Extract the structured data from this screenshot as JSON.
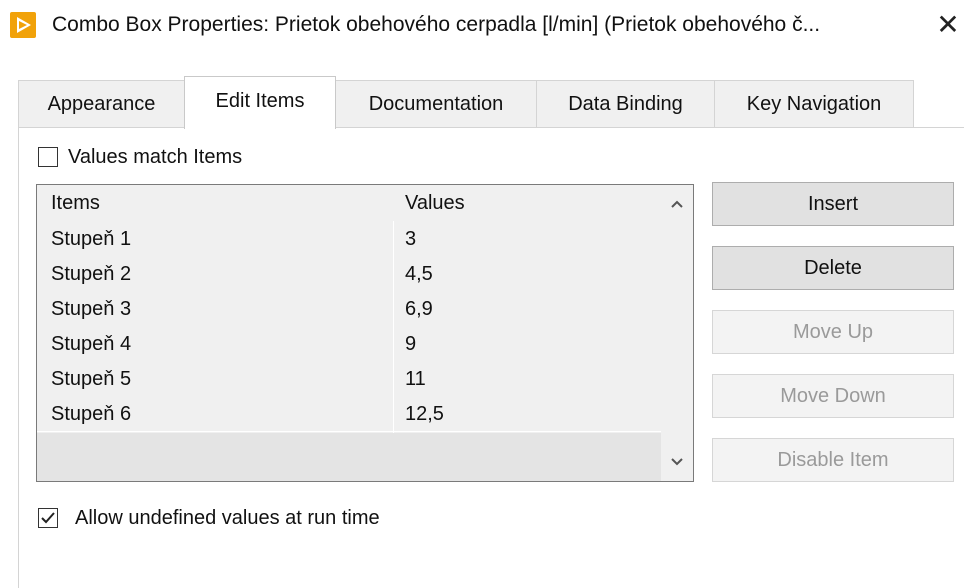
{
  "window": {
    "title": "Combo Box Properties: Prietok obehového cerpadla [l/min] (Prietok obehového č...",
    "close_glyph": "✕",
    "icon": "labview-run-arrow-icon",
    "accent_color": "#f1a20a"
  },
  "tabs": [
    {
      "label": "Appearance",
      "active": false
    },
    {
      "label": "Edit Items",
      "active": true
    },
    {
      "label": "Documentation",
      "active": false
    },
    {
      "label": "Data Binding",
      "active": false
    },
    {
      "label": "Key Navigation",
      "active": false
    }
  ],
  "values_match_items": {
    "label": "Values match Items",
    "checked": false
  },
  "list": {
    "columns": [
      "Items",
      "Values"
    ],
    "rows": [
      {
        "item": "Stupeň 1",
        "value": "3"
      },
      {
        "item": "Stupeň 2",
        "value": "4,5"
      },
      {
        "item": "Stupeň 3",
        "value": "6,9"
      },
      {
        "item": "Stupeň 4",
        "value": "9"
      },
      {
        "item": "Stupeň 5",
        "value": "11"
      },
      {
        "item": "Stupeň 6",
        "value": "12,5"
      }
    ],
    "scroll_up_glyph": "⌃",
    "scroll_down_glyph": "⌄"
  },
  "buttons": {
    "insert": {
      "label": "Insert",
      "enabled": true
    },
    "delete": {
      "label": "Delete",
      "enabled": true
    },
    "move_up": {
      "label": "Move Up",
      "enabled": false
    },
    "move_down": {
      "label": "Move Down",
      "enabled": false
    },
    "disable_item": {
      "label": "Disable Item",
      "enabled": false
    }
  },
  "allow_undefined": {
    "label": "Allow undefined values at run time",
    "checked": true
  }
}
